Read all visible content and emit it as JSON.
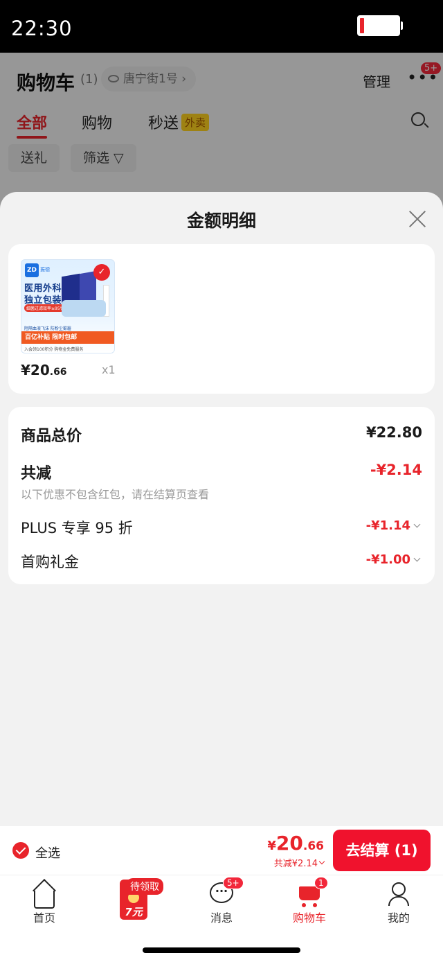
{
  "status_bar": {
    "time": "22:30"
  },
  "background_page": {
    "title": "购物车",
    "count": "(1)",
    "address": "唐宁街1号",
    "manage": "管理",
    "more_badge": "5+",
    "tabs": [
      {
        "label": "全部"
      },
      {
        "label": "购物"
      },
      {
        "label": "秒送"
      }
    ],
    "waimai_tag": "外卖",
    "chips": [
      "送礼",
      "筛选"
    ]
  },
  "sheet": {
    "title": "金额明细",
    "product": {
      "image": {
        "logo": "ZD",
        "brand": "振德",
        "line1": "医用外科",
        "line2": "独立包装",
        "red_tag": "细菌过滤效率≥95%",
        "note": "阻隔血液飞沫 防粉尘雾霾",
        "banner": "百亿补贴 限时包邮",
        "footer": "入会领100积分  购物金免费服务"
      },
      "price_int": "¥20",
      "price_dec": ".66",
      "qty": "x1"
    },
    "summary": {
      "total_label": "商品总价",
      "total_value": "¥22.80",
      "reduce_label": "共减",
      "reduce_value": "-¥2.14",
      "note": "以下优惠不包含红包，请在结算页查看",
      "discounts": [
        {
          "label": "PLUS 专享 95 折",
          "value": "-¥1.14"
        },
        {
          "label": "首购礼金",
          "value": "-¥1.00"
        }
      ]
    }
  },
  "checkout": {
    "select_all": "全选",
    "currency": "¥",
    "total_int": "20",
    "total_dec": ".66",
    "total_reduce": "共减¥2.14",
    "button": "去结算 (1)"
  },
  "tabbar": {
    "items": [
      {
        "label": "首页"
      },
      {
        "label": "消息",
        "badge": "5+"
      },
      {
        "label": "购物车",
        "badge": "1"
      },
      {
        "label": "我的"
      }
    ],
    "promo": {
      "tag": "待领取",
      "amount": "7元"
    }
  },
  "colors": {
    "accent": "#e8242b",
    "button": "#f0122d"
  }
}
